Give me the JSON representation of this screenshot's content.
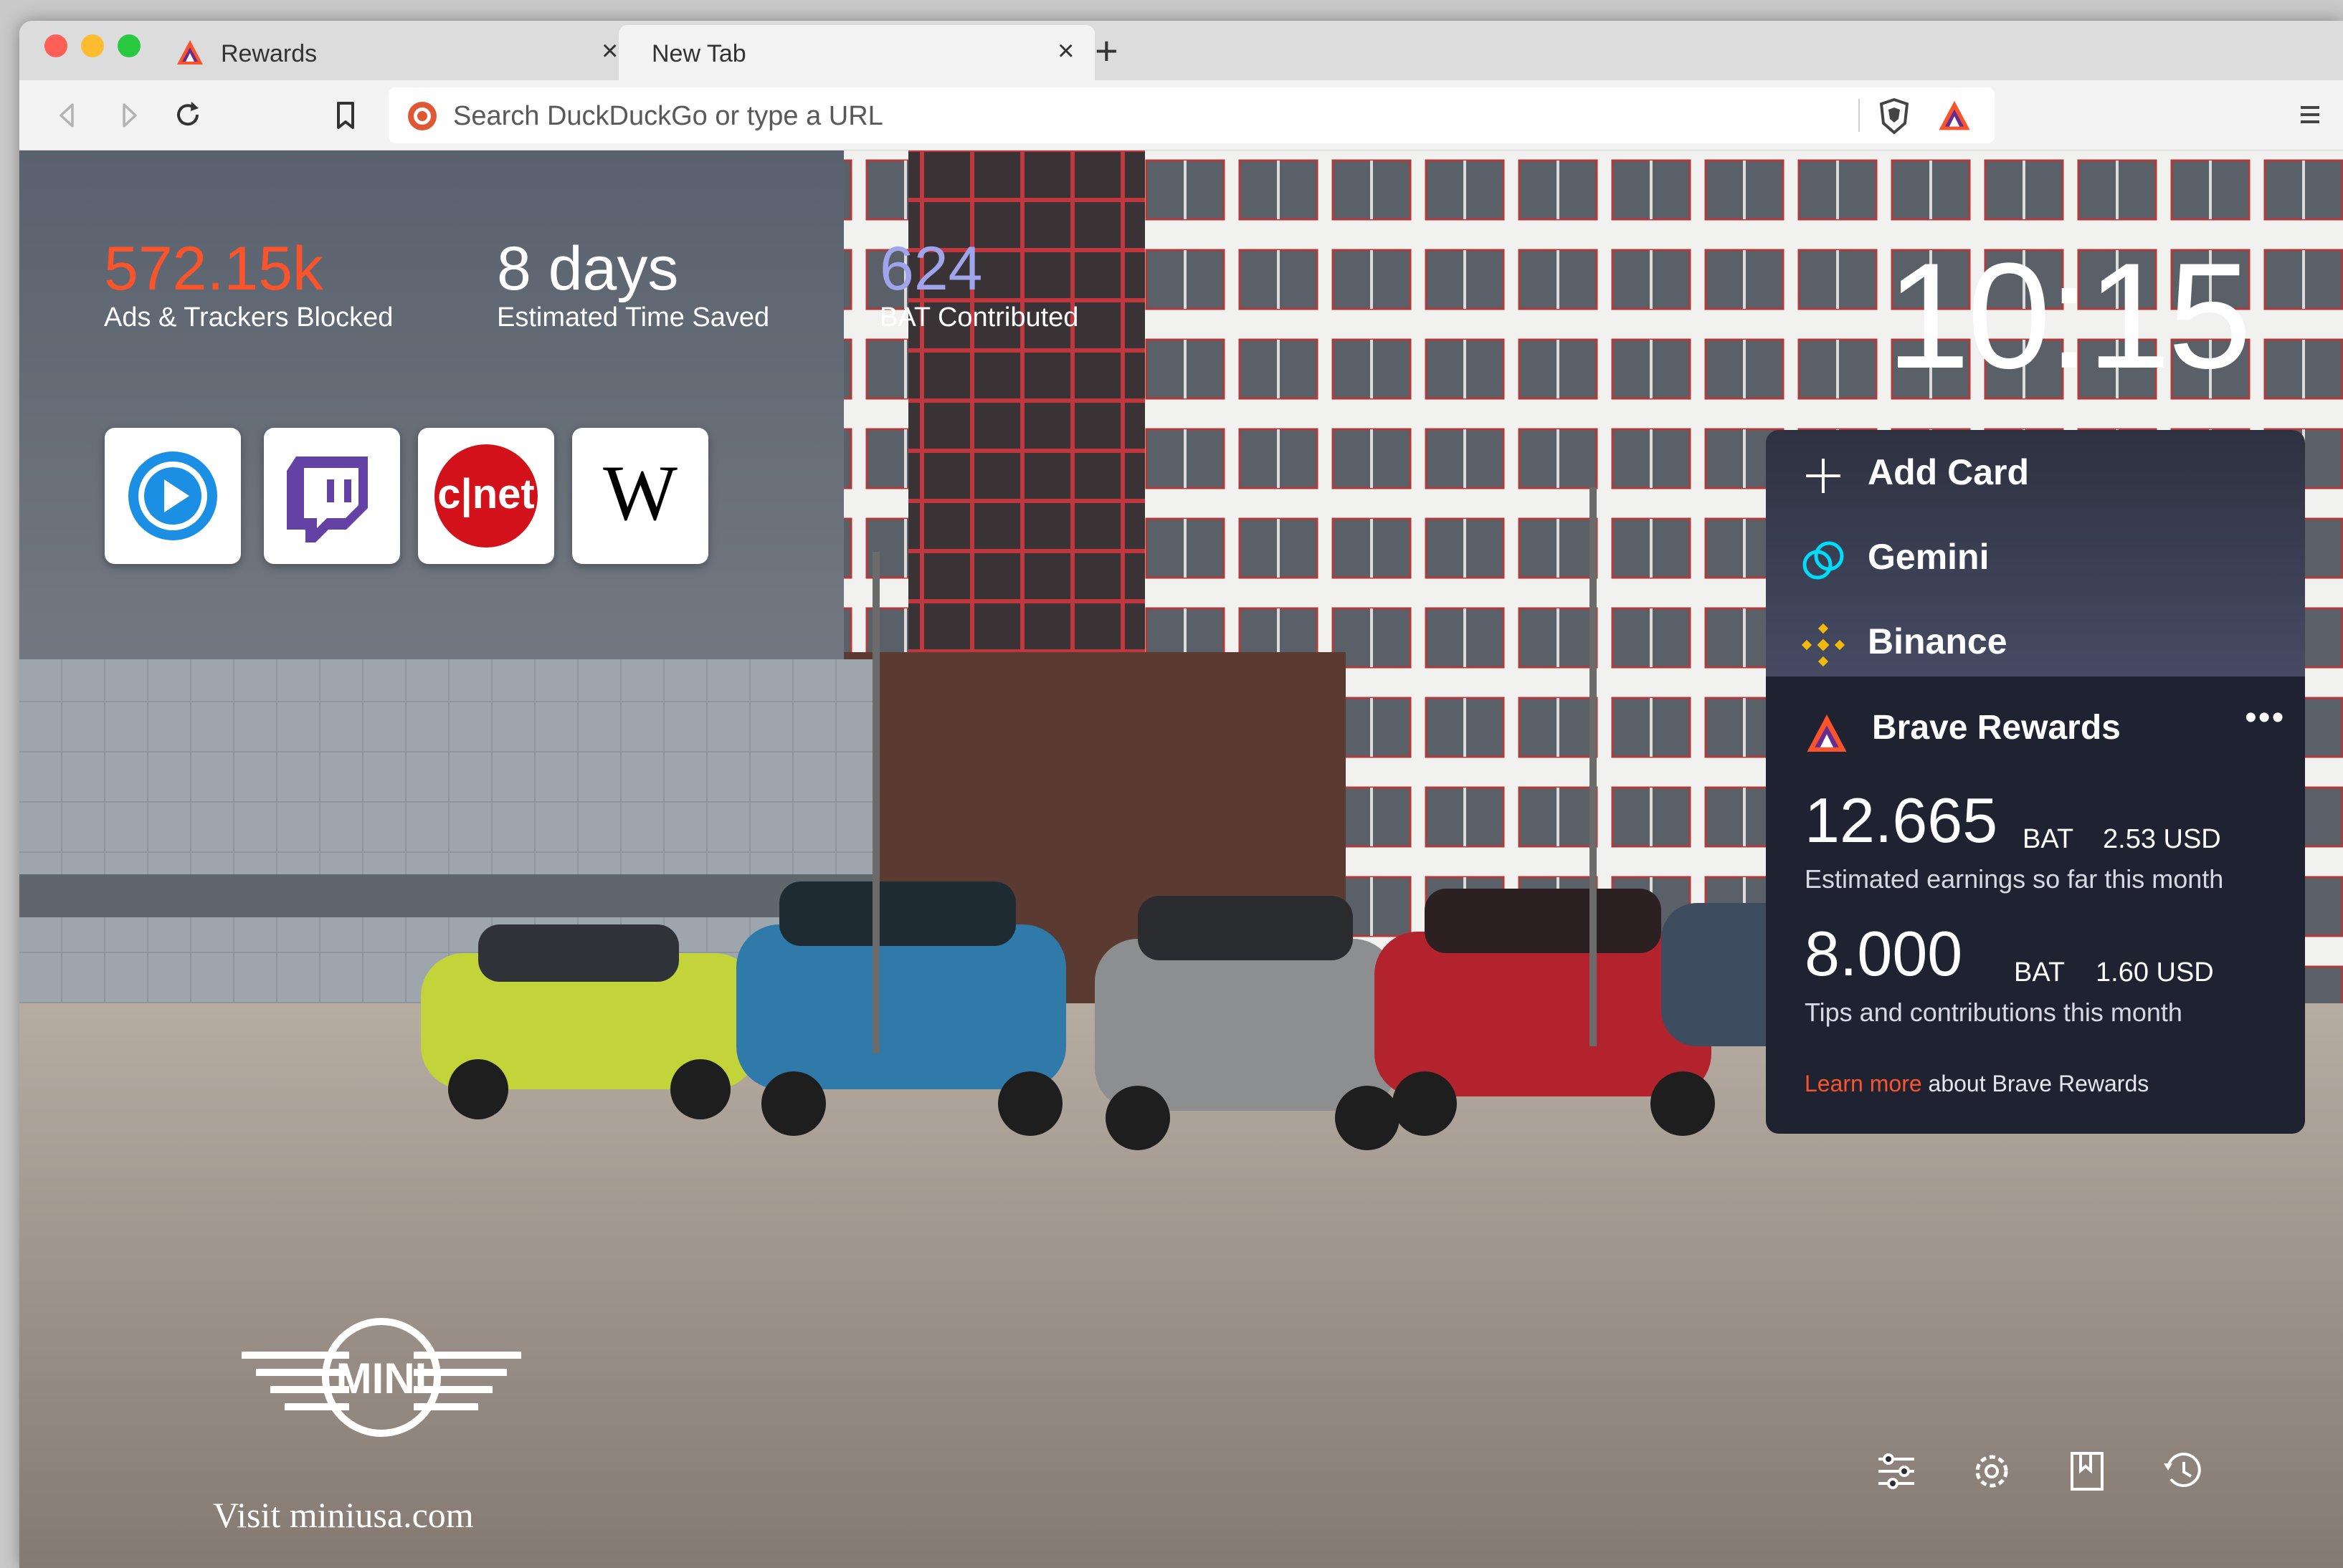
{
  "window": {
    "traffic_lights": [
      "#ff5f57",
      "#febc2e",
      "#28c840"
    ]
  },
  "tabs": [
    {
      "label": "Rewards",
      "close": "×"
    },
    {
      "label": "New Tab",
      "close": "×"
    }
  ],
  "new_tab_glyph": "+",
  "toolbar": {
    "url_placeholder": "Search DuckDuckGo or type a URL",
    "icons": [
      "back-icon",
      "forward-icon",
      "reload-icon",
      "bookmark-icon",
      "duckduckgo-icon",
      "brave-shields-icon",
      "brave-rewards-icon",
      "menu-icon"
    ]
  },
  "stats": [
    {
      "value": "572.15k",
      "label": "Ads & Trackers Blocked",
      "color": "#fb542b"
    },
    {
      "value": "8 days",
      "label": "Estimated Time Saved",
      "color": "#ffffff"
    },
    {
      "value": "624",
      "label": "BAT Contributed",
      "color": "#a0a5eb"
    }
  ],
  "top_sites": [
    "video-player-site",
    "twitch",
    "cnet",
    "wikipedia"
  ],
  "clock": "10:15",
  "cards": [
    {
      "label": "Add Card",
      "icon": "plus-icon"
    },
    {
      "label": "Gemini",
      "icon": "gemini-icon"
    },
    {
      "label": "Binance",
      "icon": "binance-icon"
    }
  ],
  "rewards": {
    "title": "Brave Rewards",
    "menu": "•••",
    "earnings": {
      "amount": "12.665",
      "unit": "BAT",
      "usd": "2.53 USD",
      "desc": "Estimated earnings so far this month"
    },
    "tips": {
      "amount": "8.000",
      "unit": "BAT",
      "usd": "1.60 USD",
      "desc": "Tips and contributions this month"
    },
    "learn_link": "Learn more",
    "learn_rest": " about Brave Rewards"
  },
  "sponsor": {
    "logo_text": "MINI",
    "cta": "Visit miniusa.com"
  },
  "bottom_controls": [
    "customize-icon",
    "settings-icon",
    "bookmarks-icon",
    "history-icon"
  ]
}
